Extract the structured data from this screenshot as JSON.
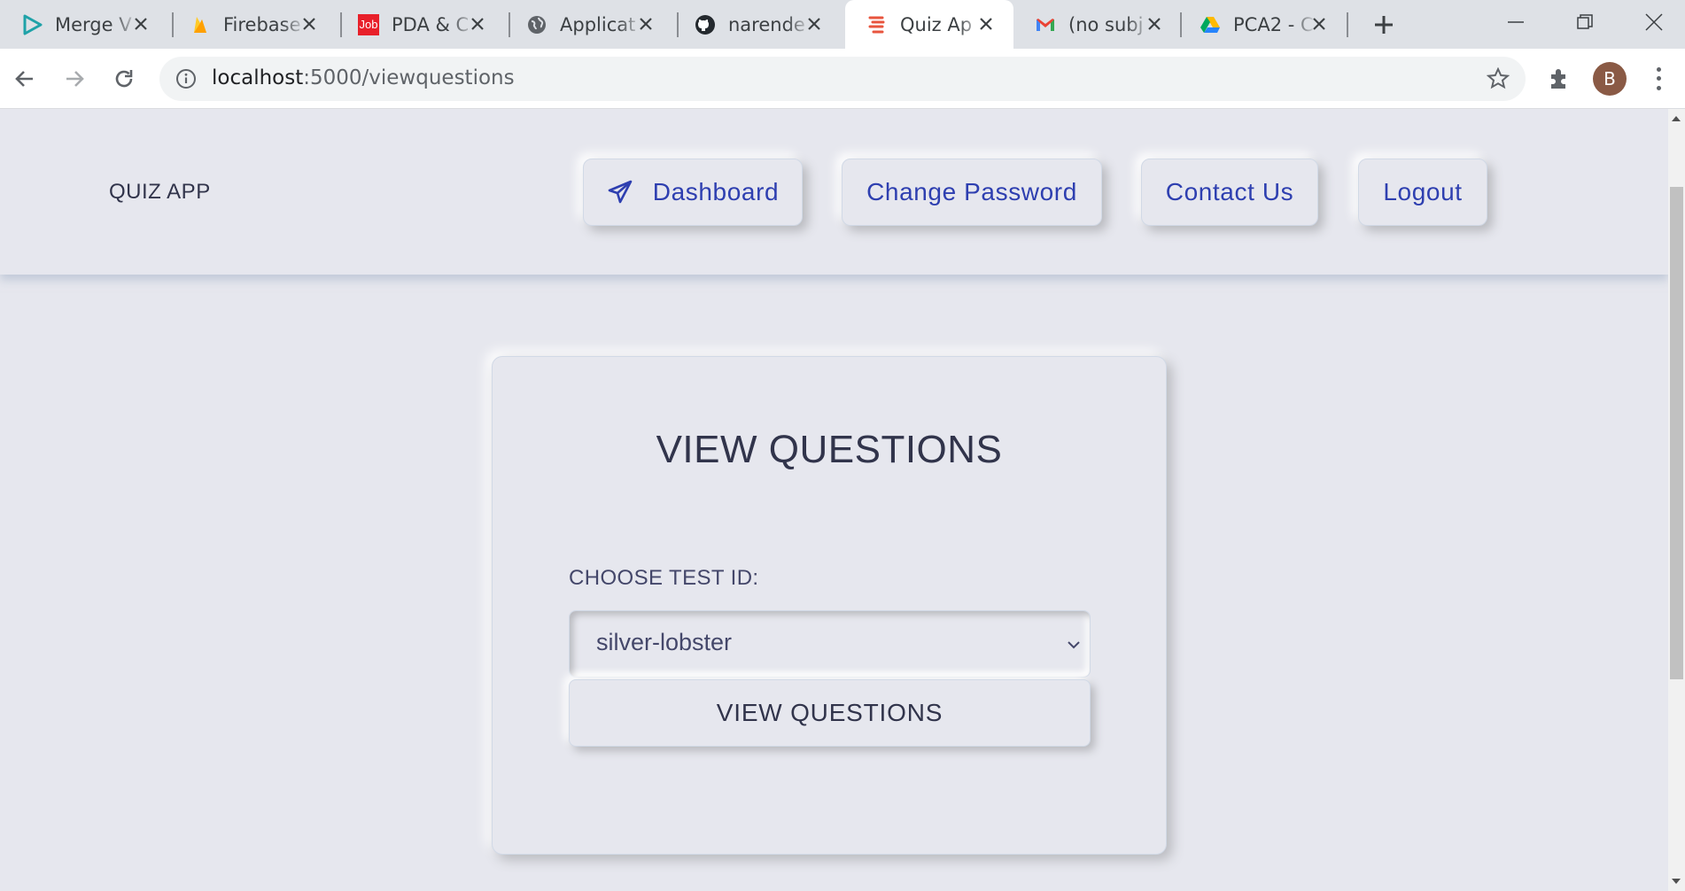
{
  "browser": {
    "tabs": [
      {
        "title": "Merge V",
        "icon": "play-icon",
        "active": false
      },
      {
        "title": "Firebase",
        "icon": "firebase-icon",
        "active": false
      },
      {
        "title": "PDA & C",
        "icon": "job-icon",
        "icon_text": "Job",
        "active": false
      },
      {
        "title": "Applicat",
        "icon": "globe-icon",
        "active": false
      },
      {
        "title": "narende",
        "icon": "github-icon",
        "active": false
      },
      {
        "title": "Quiz Ap",
        "icon": "quiz-icon",
        "active": true
      },
      {
        "title": "(no subj",
        "icon": "gmail-icon",
        "active": false
      },
      {
        "title": "PCA2 - C",
        "icon": "drive-icon",
        "active": false
      }
    ],
    "url_host": "localhost",
    "url_rest": ":5000/viewquestions",
    "profile_initial": "B"
  },
  "navbar": {
    "brand": "QUIZ APP",
    "links": [
      {
        "label": "Dashboard",
        "icon": "paper-plane-icon"
      },
      {
        "label": "Change Password"
      },
      {
        "label": "Contact Us"
      },
      {
        "label": "Logout"
      }
    ]
  },
  "card": {
    "title": "VIEW QUESTIONS",
    "field_label": "CHOOSE TEST ID:",
    "selected_test_id": "silver-lobster",
    "submit_label": "VIEW QUESTIONS"
  },
  "colors": {
    "background": "#e6e7ee",
    "link": "#2e3fb0",
    "text": "#31344b",
    "tabstrip": "#dee1e6"
  }
}
